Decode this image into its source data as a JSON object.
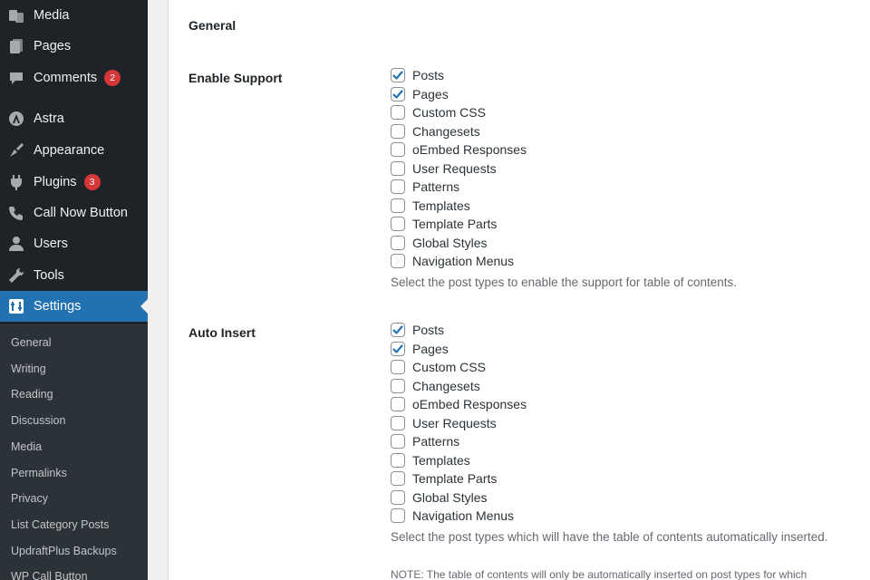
{
  "sidebar": {
    "items": [
      {
        "label": "Media",
        "icon": "media-icon",
        "badge": null
      },
      {
        "label": "Pages",
        "icon": "pages-icon",
        "badge": null
      },
      {
        "label": "Comments",
        "icon": "comments-icon",
        "badge": "2"
      },
      {
        "label": "Astra",
        "icon": "astra-icon",
        "badge": null
      },
      {
        "label": "Appearance",
        "icon": "appearance-icon",
        "badge": null
      },
      {
        "label": "Plugins",
        "icon": "plugins-icon",
        "badge": "3"
      },
      {
        "label": "Call Now Button",
        "icon": "phone-icon",
        "badge": null
      },
      {
        "label": "Users",
        "icon": "users-icon",
        "badge": null
      },
      {
        "label": "Tools",
        "icon": "tools-icon",
        "badge": null
      },
      {
        "label": "Settings",
        "icon": "settings-icon",
        "badge": null,
        "active": true
      }
    ],
    "submenu": [
      "General",
      "Writing",
      "Reading",
      "Discussion",
      "Media",
      "Permalinks",
      "Privacy",
      "List Category Posts",
      "UpdraftPlus Backups",
      "WP Call Button"
    ]
  },
  "main": {
    "section_title": "General",
    "enable_support": {
      "label": "Enable Support",
      "options": [
        {
          "label": "Posts",
          "checked": true
        },
        {
          "label": "Pages",
          "checked": true
        },
        {
          "label": "Custom CSS",
          "checked": false
        },
        {
          "label": "Changesets",
          "checked": false
        },
        {
          "label": "oEmbed Responses",
          "checked": false
        },
        {
          "label": "User Requests",
          "checked": false
        },
        {
          "label": "Patterns",
          "checked": false
        },
        {
          "label": "Templates",
          "checked": false
        },
        {
          "label": "Template Parts",
          "checked": false
        },
        {
          "label": "Global Styles",
          "checked": false
        },
        {
          "label": "Navigation Menus",
          "checked": false
        }
      ],
      "description": "Select the post types to enable the support for table of contents."
    },
    "auto_insert": {
      "label": "Auto Insert",
      "options": [
        {
          "label": "Posts",
          "checked": true
        },
        {
          "label": "Pages",
          "checked": true
        },
        {
          "label": "Custom CSS",
          "checked": false
        },
        {
          "label": "Changesets",
          "checked": false
        },
        {
          "label": "oEmbed Responses",
          "checked": false
        },
        {
          "label": "User Requests",
          "checked": false
        },
        {
          "label": "Patterns",
          "checked": false
        },
        {
          "label": "Templates",
          "checked": false
        },
        {
          "label": "Template Parts",
          "checked": false
        },
        {
          "label": "Global Styles",
          "checked": false
        },
        {
          "label": "Navigation Menus",
          "checked": false
        }
      ],
      "description": "Select the post types which will have the table of contents automatically inserted.",
      "note": "NOTE: The table of contents will only be automatically inserted on post types for which"
    }
  },
  "colors": {
    "accent": "#2271b1",
    "badge": "#d63638",
    "sidebar_bg": "#1d2327"
  }
}
